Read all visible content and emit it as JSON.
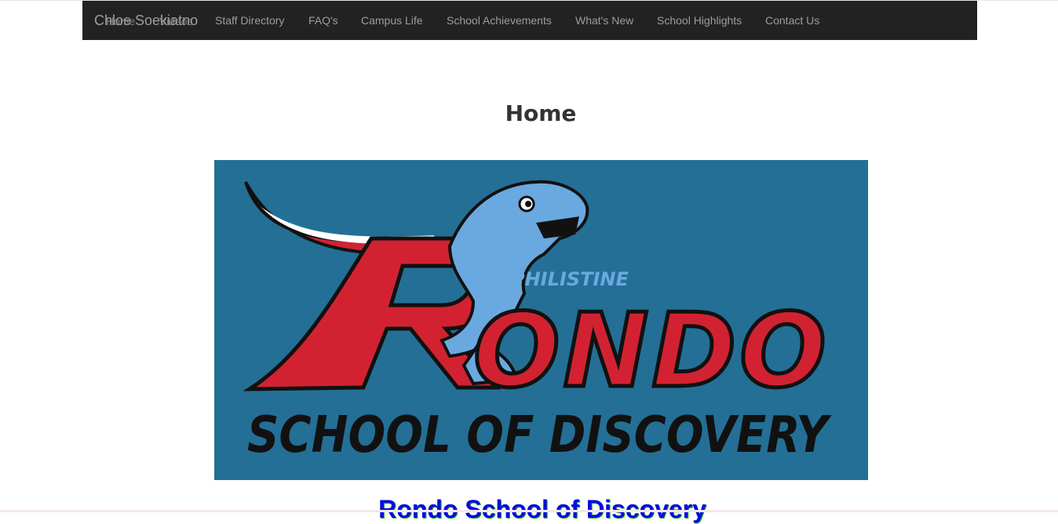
{
  "navbar": {
    "brand": "Chloe Soekiatno",
    "overlap_home": "Home",
    "overlap_videos": "Videos",
    "items": [
      {
        "label": "Staff Directory"
      },
      {
        "label": "FAQ's"
      },
      {
        "label": "Campus Life"
      },
      {
        "label": "School Achievements"
      },
      {
        "label": "What's New"
      },
      {
        "label": "School Highlights"
      },
      {
        "label": "Contact Us"
      }
    ]
  },
  "main": {
    "title": "Home",
    "logo": {
      "text_top": "PHILISTINE",
      "text_main_r": "R",
      "text_main_rest": "ONDO",
      "text_bottom": "SCHOOL OF DISCOVERY"
    },
    "school_name": "Rondo School of Discovery"
  },
  "colors": {
    "navbar_bg": "#222222",
    "nav_text": "#9d9d9d",
    "logo_bg": "#246f96",
    "logo_red": "#d22232",
    "logo_blue": "#6aa9df",
    "heading_link": "#0a0ae0"
  }
}
